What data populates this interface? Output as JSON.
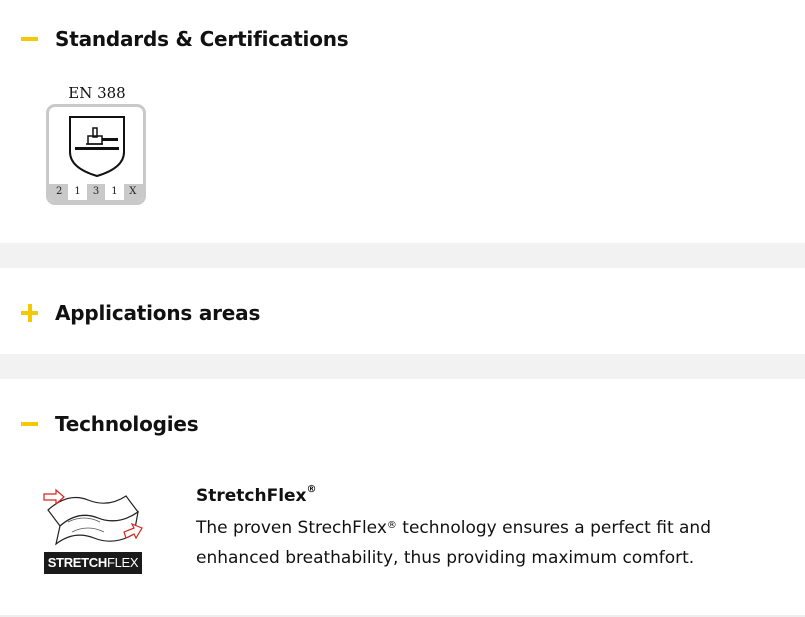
{
  "sections": {
    "standards": {
      "title": "Standards & Certifications",
      "expanded": true,
      "toggle_icon": "minus-icon",
      "certificate": {
        "label": "EN 388",
        "scores": [
          "2",
          "1",
          "3",
          "1",
          "X"
        ]
      }
    },
    "applications": {
      "title": "Applications areas",
      "expanded": false,
      "toggle_icon": "plus-icon"
    },
    "technologies": {
      "title": "Technologies",
      "expanded": true,
      "toggle_icon": "minus-icon",
      "items": [
        {
          "badge_bold": "STRETCH",
          "badge_light": "FLEX",
          "name": "StretchFlex",
          "name_mark": "®",
          "description_line1_a": "The proven StrechFlex",
          "description_line1_mark": "®",
          "description_line1_b": " technology ensures a perfect fit and",
          "description_line2": "enhanced breathability, thus providing maximum comfort."
        }
      ]
    }
  },
  "colors": {
    "accent": "#f5c800",
    "divider": "#f2f2f2",
    "badge_bg": "#1a1a1a"
  }
}
